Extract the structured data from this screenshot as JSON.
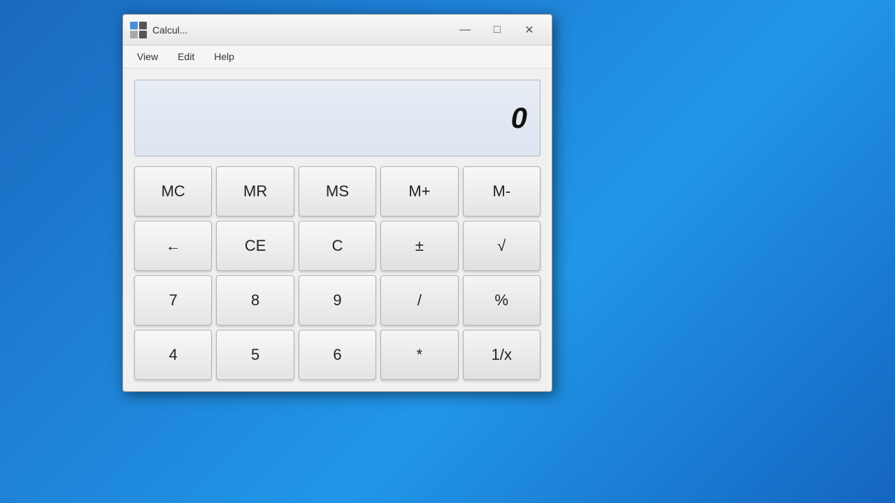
{
  "window": {
    "title": "Calcul...",
    "icon_label": "calculator-icon"
  },
  "controls": {
    "minimize": "—",
    "maximize": "□",
    "close": "✕"
  },
  "menu": {
    "items": [
      "View",
      "Edit",
      "Help"
    ]
  },
  "display": {
    "value": "0"
  },
  "buttons": {
    "row_memory": [
      "MC",
      "MR",
      "MS",
      "M+",
      "M-"
    ],
    "row_ops": [
      "←",
      "CE",
      "C",
      "±",
      "√"
    ],
    "row_789": [
      "7",
      "8",
      "9",
      "/",
      "%"
    ],
    "row_456": [
      "4",
      "5",
      "6",
      "*",
      "1/x"
    ]
  }
}
